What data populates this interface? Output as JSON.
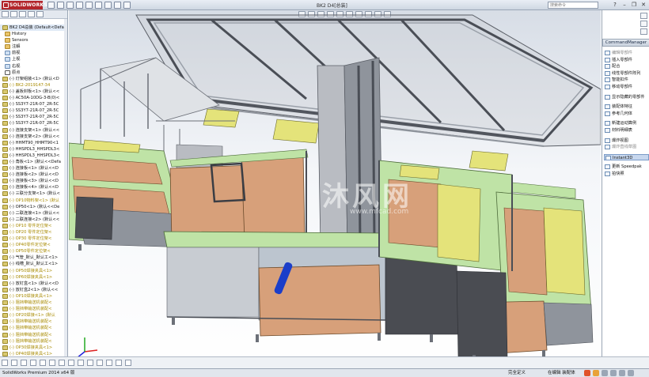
{
  "app": {
    "brand": "SOLIDWORKS",
    "document_title": "BK2 D4[总装]",
    "search_placeholder": "搜索命令",
    "window_buttons": [
      "?",
      "–",
      "❐",
      "✕"
    ]
  },
  "feature_tree": {
    "items": [
      {
        "label": "BK2 D4总装 (Default<Defa",
        "icon": "assembly-icon",
        "style": ""
      },
      {
        "label": "History",
        "icon": "history-icon",
        "style": "sub"
      },
      {
        "label": "Sensors",
        "icon": "sensor-icon",
        "style": "sub"
      },
      {
        "label": "注解",
        "icon": "annotation-icon",
        "style": "sub"
      },
      {
        "label": "前视",
        "icon": "plane-icon",
        "style": "sub"
      },
      {
        "label": "上视",
        "icon": "plane-icon",
        "style": "sub"
      },
      {
        "label": "右视",
        "icon": "plane-icon",
        "style": "sub"
      },
      {
        "label": "原点",
        "icon": "origin-icon",
        "style": "sub"
      },
      {
        "label": "(-) 灯架组装<1> (默认<D",
        "icon": "part-icon",
        "style": ""
      },
      {
        "label": "(-) BK2-2019147-34",
        "icon": "part-icon",
        "style": "y"
      },
      {
        "label": "(-) 盖板封板<1> (默认<<",
        "icon": "part-icon",
        "style": ""
      },
      {
        "label": "(-) AC50A-10DG-3-B(0)<",
        "icon": "part-icon",
        "style": ""
      },
      {
        "label": "(-) SS3Y7-21R-07_2R-5C",
        "icon": "part-icon",
        "style": ""
      },
      {
        "label": "(-) SS3Y7-21R-07_2R-5C",
        "icon": "part-icon",
        "style": ""
      },
      {
        "label": "(-) SS3Y7-21R-07_2R-5C",
        "icon": "part-icon",
        "style": ""
      },
      {
        "label": "(-) SS3Y7-21R-07_2R-5C",
        "icon": "part-icon",
        "style": ""
      },
      {
        "label": "(-) 连接支架<1> (默认<<",
        "icon": "part-icon",
        "style": ""
      },
      {
        "label": "(-) 连接支架<2> (默认<<",
        "icon": "part-icon",
        "style": ""
      },
      {
        "label": "(-) HHMT90_HHMT90<1",
        "icon": "part-icon",
        "style": ""
      },
      {
        "label": "(-) HHSPDL3_HHSPDL3<",
        "icon": "part-icon",
        "style": ""
      },
      {
        "label": "(-) HHSPDL3_HHSPDL3<",
        "icon": "part-icon",
        "style": ""
      },
      {
        "label": "(-) 角板<1> (默认<<Defa",
        "icon": "part-icon",
        "style": ""
      },
      {
        "label": "(-) 连接板<1> (默认<<D",
        "icon": "part-icon",
        "style": ""
      },
      {
        "label": "(-) 连接板<2> (默认<<D",
        "icon": "part-icon",
        "style": ""
      },
      {
        "label": "(-) 连接板<3> (默认<<D",
        "icon": "part-icon",
        "style": ""
      },
      {
        "label": "(-) 连接板<4> (默认<<D",
        "icon": "part-icon",
        "style": ""
      },
      {
        "label": "(-) 三联分支架<1> (默认<",
        "icon": "part-icon",
        "style": ""
      },
      {
        "label": "(-) OP10物料架<1> (默认",
        "icon": "part-icon",
        "style": "y"
      },
      {
        "label": "(-) OP50<1> (默认<<De",
        "icon": "part-icon",
        "style": ""
      },
      {
        "label": "(-) 二联连接<1> (默认<<",
        "icon": "part-icon",
        "style": ""
      },
      {
        "label": "(-) 二联连接<2> (默认<<",
        "icon": "part-icon",
        "style": ""
      },
      {
        "label": "(-) OP10 零件定位架<",
        "icon": "part-icon",
        "style": "y"
      },
      {
        "label": "(-) OP20 零件定位架<",
        "icon": "part-icon",
        "style": "y"
      },
      {
        "label": "(-) OP30 零件定位架<",
        "icon": "part-icon",
        "style": "y"
      },
      {
        "label": "(-) OP40零件定位架<",
        "icon": "part-icon",
        "style": "y"
      },
      {
        "label": "(-) OP50零件定位架<",
        "icon": "part-icon",
        "style": "y"
      },
      {
        "label": "(-) 气管_默认_默认工<1>",
        "icon": "part-icon",
        "style": ""
      },
      {
        "label": "(-) 线槽_默认_默认工<1>",
        "icon": "part-icon",
        "style": ""
      },
      {
        "label": "(-) OP50焊接夹具<1>",
        "icon": "part-icon",
        "style": "y"
      },
      {
        "label": "(-) OP60焊接夹具<1>",
        "icon": "part-icon",
        "style": "y"
      },
      {
        "label": "(-) 放钉盒<1> (默认<<D",
        "icon": "part-icon",
        "style": ""
      },
      {
        "label": "(-) 放钉盒2<1> (默认<<",
        "icon": "part-icon",
        "style": ""
      },
      {
        "label": "(-) OP10焊接夹具<1>",
        "icon": "part-icon",
        "style": "y"
      },
      {
        "label": "(-) 阻挡带输送机装配<",
        "icon": "part-icon",
        "style": "y"
      },
      {
        "label": "(-) 阻挡带输送机装配<",
        "icon": "part-icon",
        "style": "y"
      },
      {
        "label": "(-) OP20焊接<1> (默认",
        "icon": "part-icon",
        "style": "y"
      },
      {
        "label": "(-) 阻挡带输送机装配<",
        "icon": "part-icon",
        "style": "y"
      },
      {
        "label": "(-) 阻挡带输送机装配<",
        "icon": "part-icon",
        "style": "y"
      },
      {
        "label": "(-) 阻挡带输送机装配<",
        "icon": "part-icon",
        "style": "y"
      },
      {
        "label": "(-) 阻挡带输送机装配<",
        "icon": "part-icon",
        "style": "y"
      },
      {
        "label": "(-) OP30焊接夹具<1>",
        "icon": "part-icon",
        "style": "y"
      },
      {
        "label": "(-) OP40焊接夹具<1>",
        "icon": "part-icon",
        "style": "y"
      }
    ]
  },
  "command_manager": {
    "header": "CommandManager",
    "items": [
      {
        "label": "编辑零部件",
        "state": "dim"
      },
      {
        "label": "插入零部件",
        "state": ""
      },
      {
        "label": "配合",
        "state": ""
      },
      {
        "label": "线性零部件阵列",
        "state": ""
      },
      {
        "label": "智能扣件",
        "state": ""
      },
      {
        "label": "移动零部件",
        "state": ""
      },
      {
        "label": "",
        "state": "sep"
      },
      {
        "label": "显示隐藏的零部件",
        "state": ""
      },
      {
        "label": "",
        "state": "sep"
      },
      {
        "label": "装配体特征",
        "state": ""
      },
      {
        "label": "参考几何体",
        "state": ""
      },
      {
        "label": "",
        "state": "sep"
      },
      {
        "label": "新建运动算例",
        "state": ""
      },
      {
        "label": "材料明细表",
        "state": ""
      },
      {
        "label": "",
        "state": "sep"
      },
      {
        "label": "爆炸视图",
        "state": ""
      },
      {
        "label": "爆炸直线草图",
        "state": "dim"
      },
      {
        "label": "",
        "state": "sep"
      },
      {
        "label": "Instant3D",
        "state": "sel"
      },
      {
        "label": "",
        "state": "sep"
      },
      {
        "label": "更新 Speedpak",
        "state": ""
      },
      {
        "label": "拍快照",
        "state": ""
      }
    ]
  },
  "viewport": {
    "watermark": "沐风网",
    "watermark_url": "www.mfcad.com"
  },
  "status_bar": {
    "version": "SolidWorks Premium 2014 x64 版",
    "definition_state": "完全定义",
    "edit_state": "在编辑 装配体"
  },
  "colors": {
    "frame_gray": "#b9bcc2",
    "panel_green": "#bfe3a6",
    "panel_orange": "#d7a07a",
    "panel_yellow": "#e4e37a",
    "dark_cabinet": "#4a4c52",
    "accent_blue": "#1b3ec9"
  }
}
